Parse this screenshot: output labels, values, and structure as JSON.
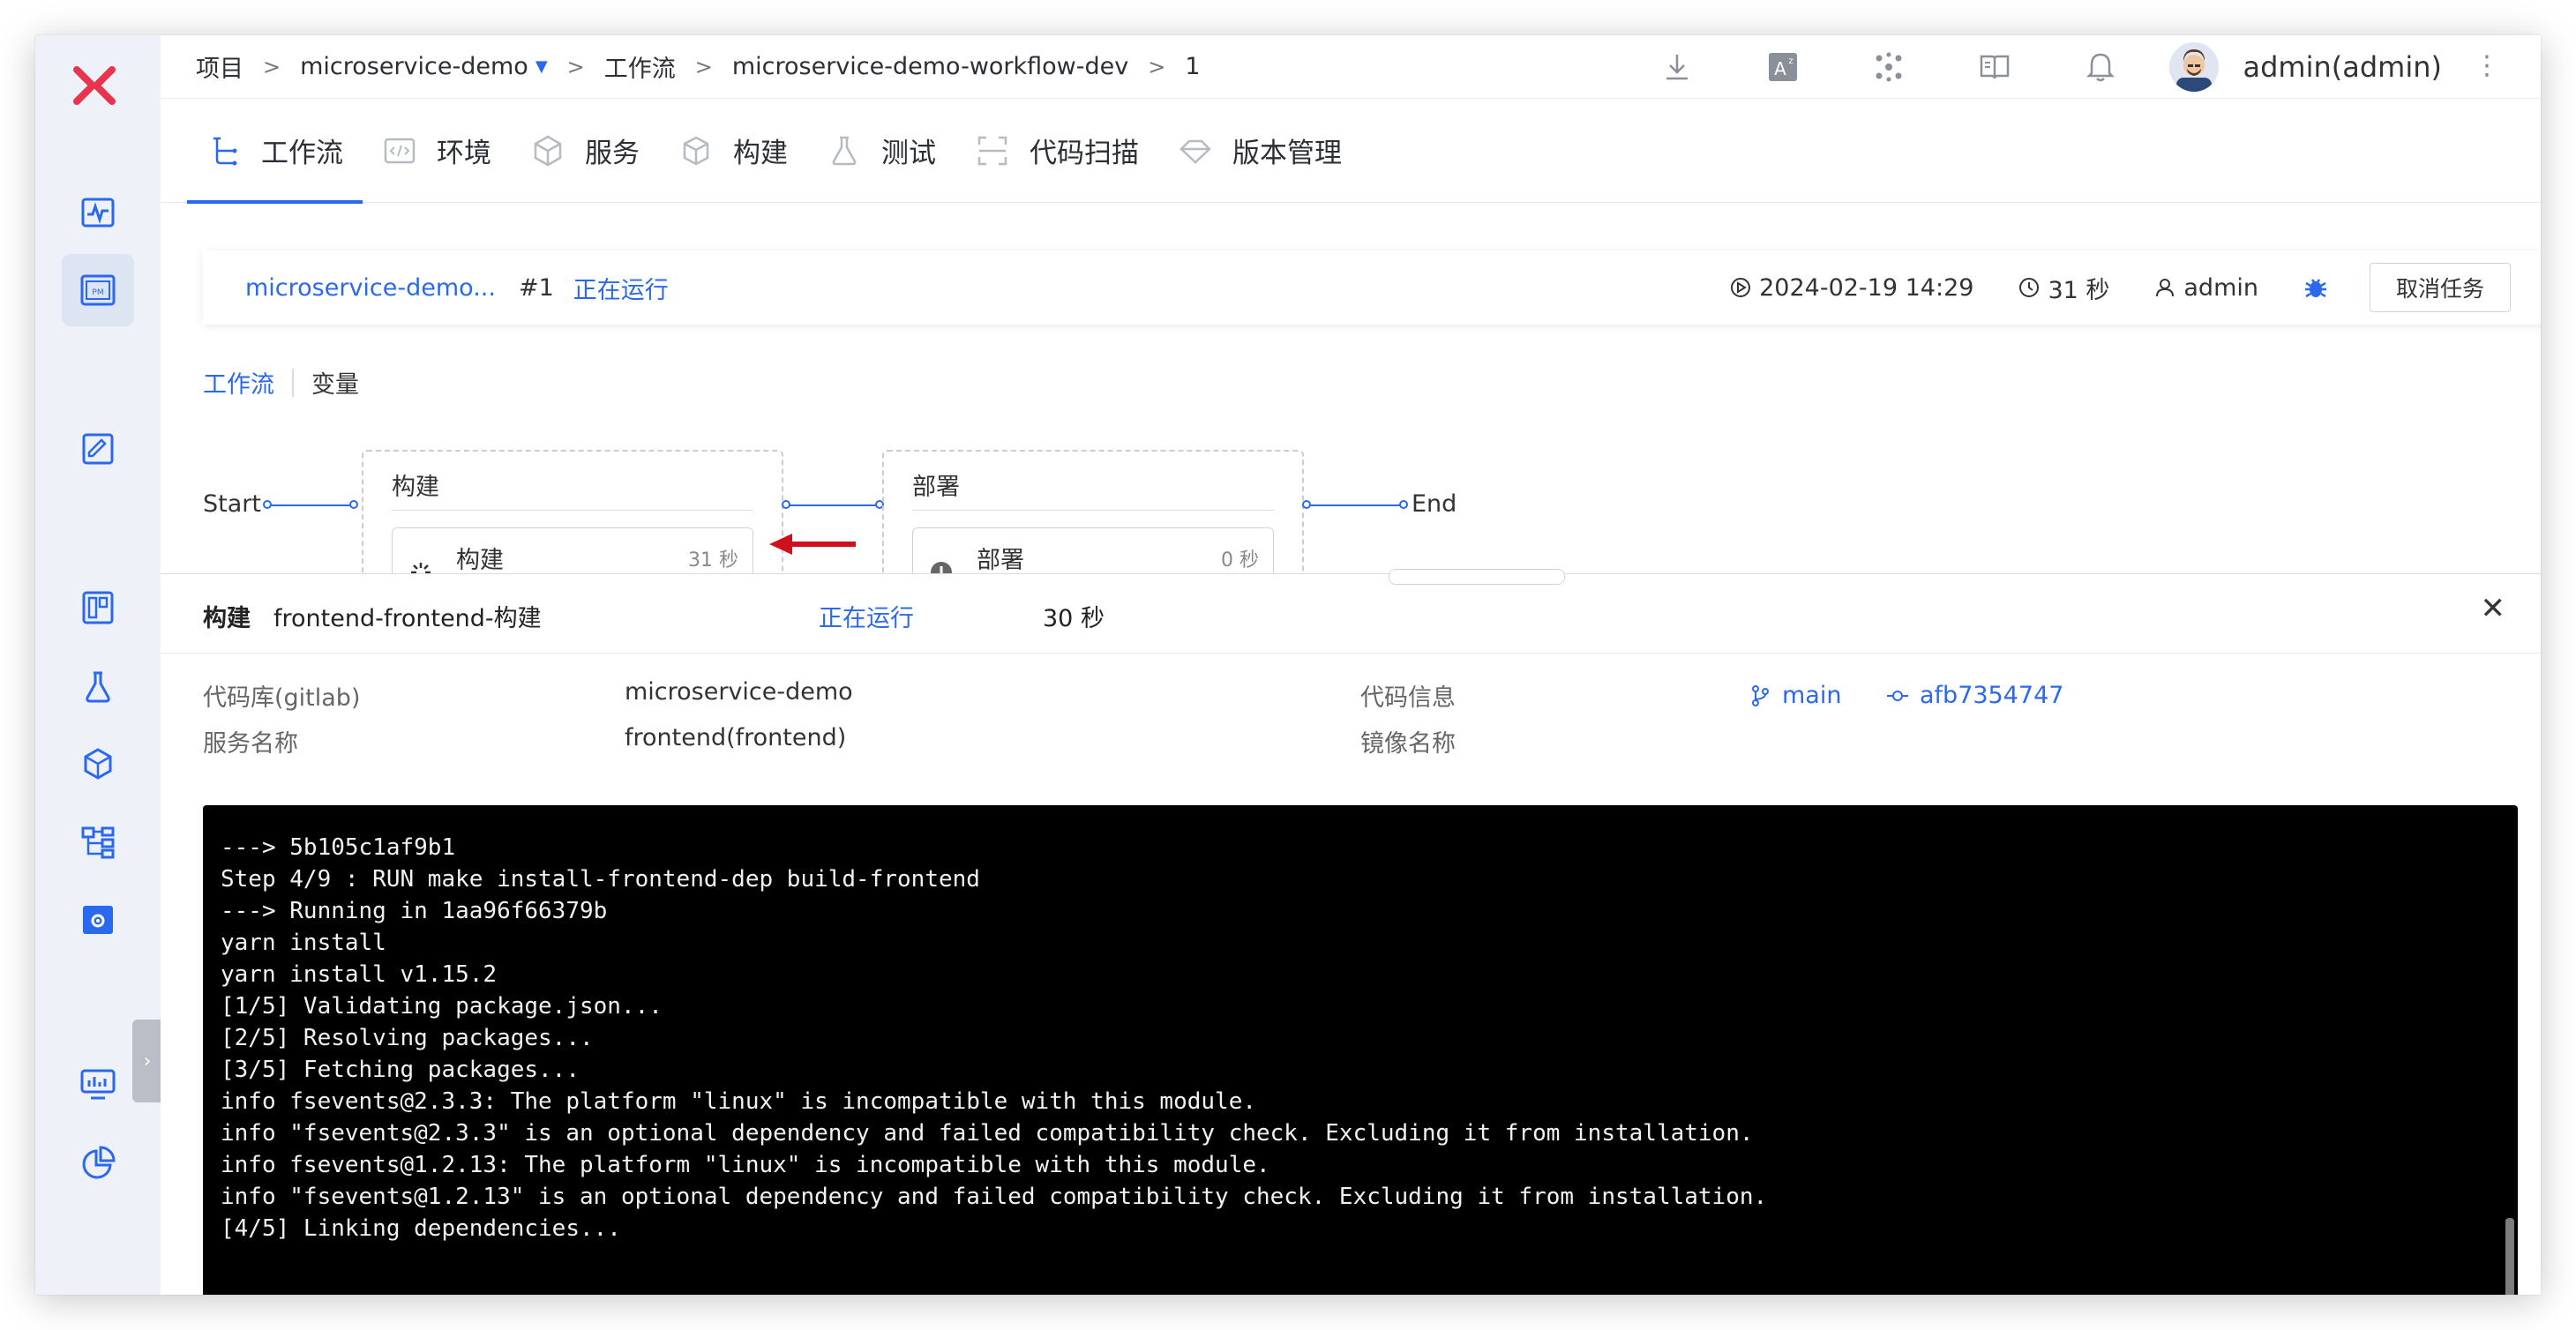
{
  "breadcrumb": {
    "root": "项目",
    "project": "microservice-demo",
    "section": "工作流",
    "workflow": "microservice-demo-workflow-dev",
    "run": "1",
    "separator": ">"
  },
  "user": {
    "name": "admin(admin)"
  },
  "header_icons": [
    "download-icon",
    "translate-icon",
    "cluster-icon",
    "docs-icon",
    "bell-icon"
  ],
  "tabs": [
    {
      "label": "工作流",
      "icon": "workflow-icon",
      "active": true
    },
    {
      "label": "环境",
      "icon": "code-icon"
    },
    {
      "label": "服务",
      "icon": "service-cube-icon"
    },
    {
      "label": "构建",
      "icon": "build-box-icon"
    },
    {
      "label": "测试",
      "icon": "flask-icon"
    },
    {
      "label": "代码扫描",
      "icon": "scan-icon"
    },
    {
      "label": "版本管理",
      "icon": "diamond-icon"
    }
  ],
  "run": {
    "name": "microservice-demo...",
    "number": "#1",
    "status": "正在运行",
    "started": "2024-02-19 14:29",
    "duration": "31 秒",
    "user": "admin",
    "cancel_label": "取消任务"
  },
  "subtabs": {
    "workflow": "工作流",
    "variables": "变量"
  },
  "pipeline": {
    "start": "Start",
    "end": "End",
    "stages": [
      {
        "title": "构建",
        "job": "构建",
        "time": "31 秒"
      },
      {
        "title": "部署",
        "job": "部署",
        "time": "0 秒"
      }
    ]
  },
  "drawer": {
    "type": "构建",
    "name": "frontend-frontend-构建",
    "status": "正在运行",
    "duration": "30 秒",
    "close": "✕",
    "info": {
      "repo_label": "代码库(gitlab)",
      "repo_value": "microservice-demo",
      "service_label": "服务名称",
      "service_value": "frontend(frontend)",
      "code_label": "代码信息",
      "branch": "main",
      "commit": "afb7354747",
      "image_label": "镜像名称"
    },
    "log": [
      "---> 5b105c1af9b1",
      "Step 4/9 : RUN make install-frontend-dep build-frontend",
      "---> Running in 1aa96f66379b",
      "yarn install",
      "yarn install v1.15.2",
      "[1/5] Validating package.json...",
      "[2/5] Resolving packages...",
      "[3/5] Fetching packages...",
      "info fsevents@2.3.3: The platform \"linux\" is incompatible with this module.",
      "info \"fsevents@2.3.3\" is an optional dependency and failed compatibility check. Excluding it from installation.",
      "info fsevents@1.2.13: The platform \"linux\" is incompatible with this module.",
      "info \"fsevents@1.2.13\" is an optional dependency and failed compatibility check. Excluding it from installation.",
      "[4/5] Linking dependencies..."
    ]
  },
  "colors": {
    "accent": "#2b68f0",
    "logo": "#e8344e",
    "sidebar_bg": "#eef2f8",
    "console_bg": "#000000",
    "arrow": "#d0101b"
  }
}
